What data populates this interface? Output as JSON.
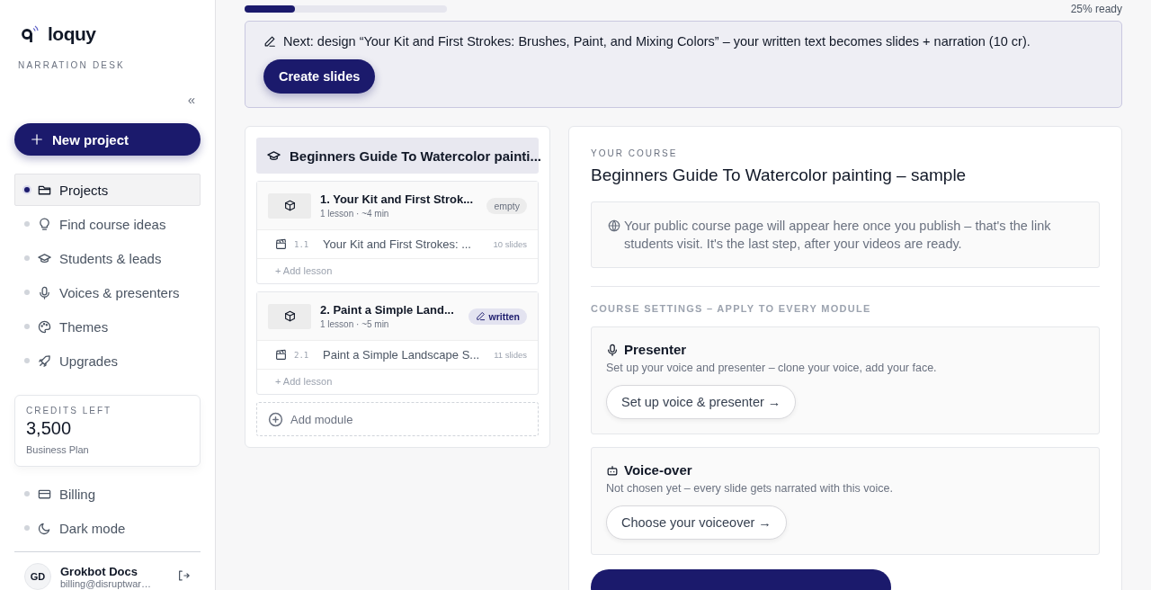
{
  "sidebar": {
    "brand": "loquy",
    "subtitle": "NARRATION DESK",
    "collapse": "«",
    "new_project": "New project",
    "nav": [
      {
        "label": "Projects",
        "selected": true
      },
      {
        "label": "Find course ideas",
        "selected": false
      },
      {
        "label": "Students & leads",
        "selected": false
      },
      {
        "label": "Voices & presenters",
        "selected": false
      },
      {
        "label": "Themes",
        "selected": false
      },
      {
        "label": "Upgrades",
        "selected": false
      }
    ],
    "credits": {
      "label": "CREDITS LEFT",
      "value": "3,500",
      "plan": "Business Plan"
    },
    "bottom_nav": [
      {
        "label": "Billing",
        "selected": false
      },
      {
        "label": "Dark mode",
        "selected": false
      }
    ],
    "user": {
      "initials": "GD",
      "name": "Grokbot Docs",
      "email": "billing@disruptwar…"
    }
  },
  "progress": {
    "level": 0.25,
    "label": "25% ready"
  },
  "banner": {
    "text": "Next: design “Your Kit and First Strokes: Brushes, Paint, and Mixing Colors” – your written text becomes slides + narration (10 cr).",
    "button": "Create slides"
  },
  "outline": {
    "course_title": "Beginners Guide To Watercolor painti...",
    "modules": [
      {
        "title": "1. Your Kit and First Strok...",
        "meta": "1 lesson · ~4 min",
        "status": {
          "kind": "empty",
          "label": "empty"
        },
        "lessons": [
          {
            "number": "1.1",
            "title": "Your Kit and First Strokes: ...",
            "slides": "10 slides"
          }
        ],
        "add_lesson": "+ Add lesson"
      },
      {
        "title": "2. Paint a Simple Land...",
        "meta": "1 lesson · ~5 min",
        "status": {
          "kind": "written",
          "label": "written"
        },
        "lessons": [
          {
            "number": "2.1",
            "title": "Paint a Simple Landscape S...",
            "slides": "11 slides"
          }
        ],
        "add_lesson": "+ Add lesson"
      }
    ],
    "add_module": "Add module"
  },
  "course": {
    "eyebrow": "YOUR COURSE",
    "title": "Beginners Guide To Watercolor painting – sample",
    "info": "Your public course page will appear here once you publish – that's the link students visit. It's the last step, after your videos are ready.",
    "settings_heading": "COURSE SETTINGS – APPLY TO EVERY MODULE",
    "settings": [
      {
        "kind": "presenter",
        "title": "Presenter",
        "description": "Set up your voice and presenter – clone your voice, add your face.",
        "button": "Set up voice & presenter →"
      },
      {
        "kind": "voiceover",
        "title": "Voice-over",
        "description": "Not chosen yet – every slide gets narrated with this voice.",
        "button": "Choose your voiceover →"
      }
    ]
  }
}
